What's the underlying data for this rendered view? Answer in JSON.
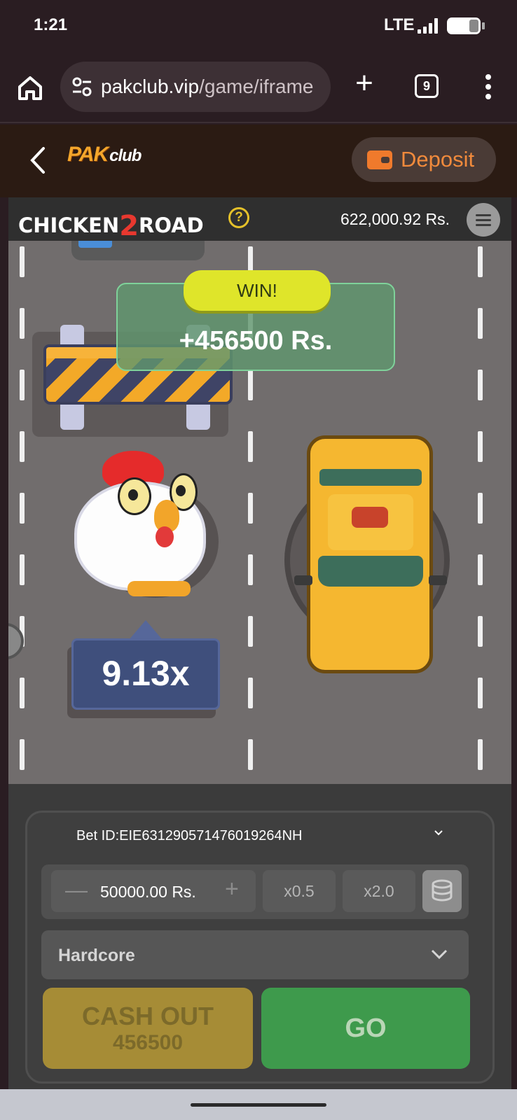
{
  "status_bar": {
    "time": "1:21",
    "network": "LTE"
  },
  "browser": {
    "url_host": "pakclub.vip",
    "url_path": "/game/iframe",
    "tab_count": "9"
  },
  "site": {
    "logo_primary": "PAK",
    "logo_secondary": "club",
    "deposit_label": "Deposit",
    "accent": "#f08a3c"
  },
  "game": {
    "title_left": "CHICKEN",
    "title_number": "2",
    "title_right": "ROAD",
    "help_label": "?",
    "balance": "622,000.92 Rs.",
    "win_label": "WIN!",
    "win_amount": "+456500 Rs.",
    "multiplier": "9.13x"
  },
  "controls": {
    "bet_id": "Bet ID:EIE631290571476019264NH",
    "stake_value": "50000.00 Rs.",
    "half_label": "x0.5",
    "double_label": "x2.0",
    "difficulty": "Hardcore",
    "cashout_label": "CASH OUT",
    "cashout_amount": "456500",
    "go_label": "GO"
  },
  "colors": {
    "go": "#3e9a4c",
    "cashout": "#a68c36",
    "win_tag": "#dfe52a",
    "multiplier_badge": "#3f4f7c"
  }
}
